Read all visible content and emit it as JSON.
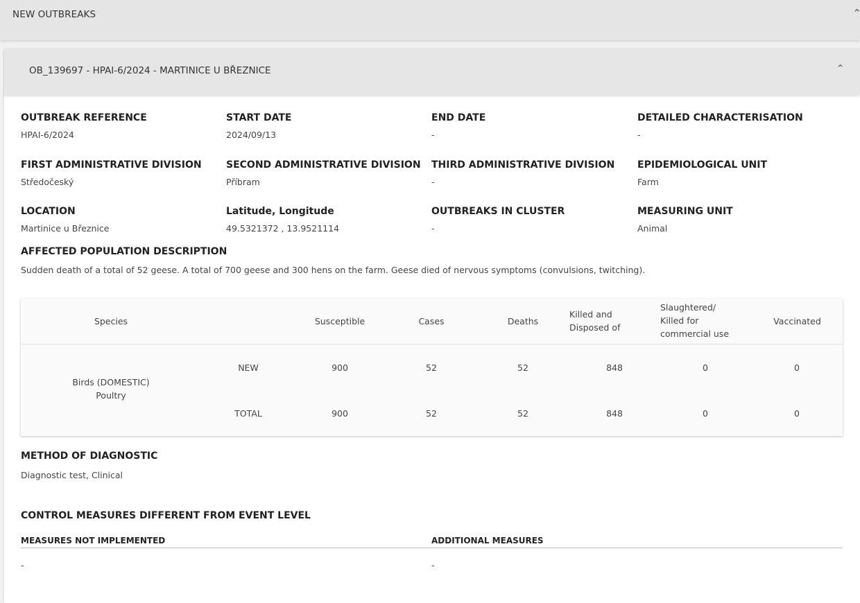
{
  "section": {
    "title": "NEW OUTBREAKS",
    "toggle_icon": "chevron-up-icon"
  },
  "outbreak": {
    "title": "OB_139697 - HPAI-6/2024 - MARTINICE U BŘEZNICE",
    "toggle_icon": "chevron-up-icon",
    "fields": [
      {
        "label": "OUTBREAK REFERENCE",
        "value": "HPAI-6/2024"
      },
      {
        "label": "START DATE",
        "value": "2024/09/13"
      },
      {
        "label": "END DATE",
        "value": "-"
      },
      {
        "label": "DETAILED CHARACTERISATION",
        "value": "-"
      },
      {
        "label": "FIRST ADMINISTRATIVE DIVISION",
        "value": "Středočeský"
      },
      {
        "label": "SECOND ADMINISTRATIVE DIVISION",
        "value": "Příbram"
      },
      {
        "label": "THIRD ADMINISTRATIVE DIVISION",
        "value": "-"
      },
      {
        "label": "EPIDEMIOLOGICAL UNIT",
        "value": "Farm"
      },
      {
        "label": "LOCATION",
        "value": "Martinice u Březnice"
      },
      {
        "label": "Latitude, Longitude",
        "value": "49.5321372 , 13.9521114"
      },
      {
        "label": "OUTBREAKS IN CLUSTER",
        "value": "-"
      },
      {
        "label": "MEASURING UNIT",
        "value": "Animal"
      }
    ],
    "affected_population": {
      "label": "AFFECTED POPULATION DESCRIPTION",
      "value": "Sudden death of a total of 52 geese. A total of 700 geese and 300 hens on the farm. Geese died of nervous symptoms (convulsions, twitching)."
    },
    "table": {
      "headers": {
        "species": "Species",
        "susceptible": "Susceptible",
        "cases": "Cases",
        "deaths": "Deaths",
        "killed_1": "Killed and",
        "killed_2": "Disposed of",
        "slaughtered_1": "Slaughtered/",
        "slaughtered_2": "Killed for",
        "slaughtered_3": "commercial use",
        "vaccinated": "Vaccinated"
      },
      "species_line1": "Birds (DOMESTIC)",
      "species_line2": "Poultry",
      "rows": [
        {
          "kind": "NEW",
          "susceptible": "900",
          "cases": "52",
          "deaths": "52",
          "killed": "848",
          "slaughtered": "0",
          "vaccinated": "0"
        },
        {
          "kind": "TOTAL",
          "susceptible": "900",
          "cases": "52",
          "deaths": "52",
          "killed": "848",
          "slaughtered": "0",
          "vaccinated": "0"
        }
      ]
    },
    "diagnostic": {
      "label": "METHOD OF DIAGNOSTIC",
      "value": "Diagnostic test, Clinical"
    },
    "control": {
      "label": "CONTROL MEASURES DIFFERENT FROM EVENT LEVEL",
      "not_implemented": {
        "label": "MEASURES NOT IMPLEMENTED",
        "value": "-"
      },
      "additional": {
        "label": "ADDITIONAL MEASURES",
        "value": "-"
      }
    }
  }
}
